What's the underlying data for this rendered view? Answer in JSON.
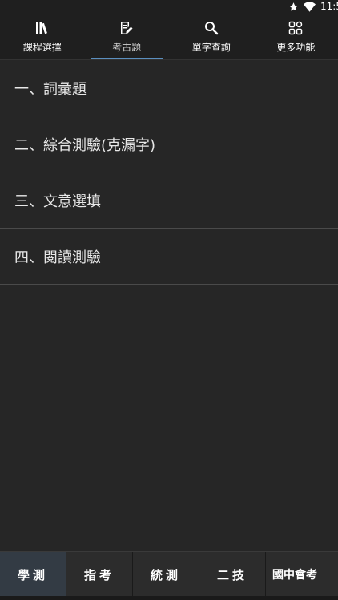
{
  "status_bar": {
    "time": "11:5",
    "icons": [
      "star-icon",
      "wifi-icon"
    ]
  },
  "top_tabs": [
    {
      "label": "課程選擇",
      "icon": "books-icon"
    },
    {
      "label": "考古題",
      "icon": "edit-note-icon",
      "active": true
    },
    {
      "label": "單字查詢",
      "icon": "search-icon"
    },
    {
      "label": "更多功能",
      "icon": "grid-icon"
    }
  ],
  "list": {
    "items": [
      {
        "label": "一、詞彙題"
      },
      {
        "label": "二、綜合測驗(克漏字)"
      },
      {
        "label": "三、文意選填"
      },
      {
        "label": "四、閱讀測驗"
      }
    ]
  },
  "bottom_tabs": [
    {
      "label": "學測",
      "active": true
    },
    {
      "label": "指考"
    },
    {
      "label": "統測"
    },
    {
      "label": "二技"
    },
    {
      "label": "國中會考"
    }
  ],
  "colors": {
    "background": "#262626",
    "header": "#1f1f1f",
    "accent": "#5b8fbf",
    "divider": "#4a4a4a"
  }
}
